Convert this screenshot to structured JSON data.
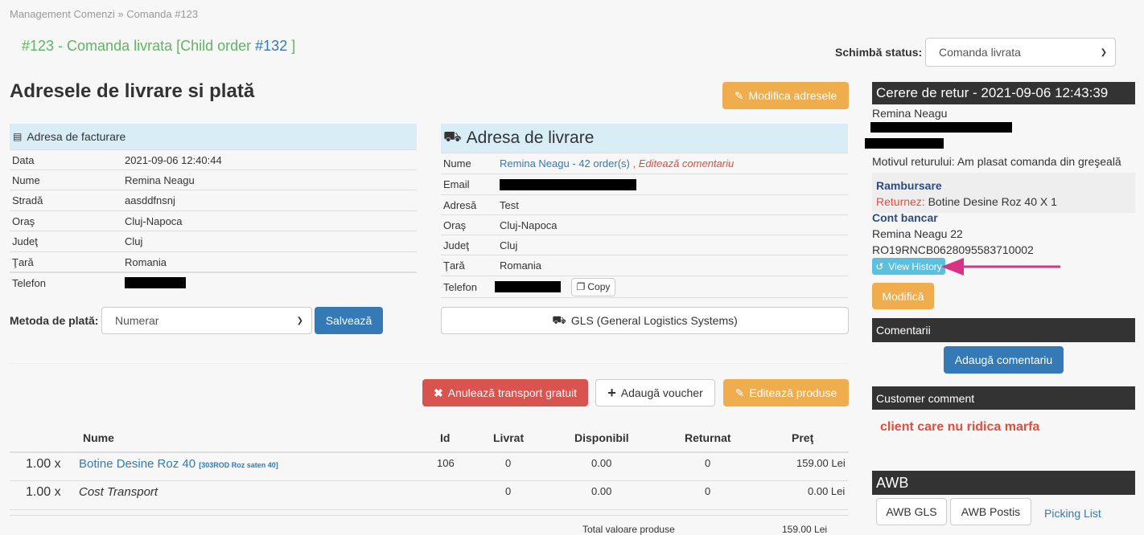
{
  "breadcrumb": "Management Comenzi » Comanda #123",
  "order_title": {
    "prefix": "#123 - Comanda livrata [Child order ",
    "link": "#132",
    "suffix": " ]"
  },
  "status": {
    "label": "Schimbă status:",
    "value": "Comanda livrata"
  },
  "addresses": {
    "heading": "Adresele de livrare si plată",
    "modify_label": "Modifica adresele"
  },
  "billing": {
    "title": "Adresa de facturare",
    "rows": [
      {
        "k": "Data",
        "v": "2021-09-06 12:40:44"
      },
      {
        "k": "Nume",
        "v": "Remina Neagu"
      },
      {
        "k": "Stradă",
        "v": "aasddfnsnj"
      },
      {
        "k": "Oraş",
        "v": "Cluj-Napoca"
      },
      {
        "k": "Judeţ",
        "v": "Cluj"
      },
      {
        "k": "Ţară",
        "v": "Romania"
      },
      {
        "k": "Telefon",
        "v": ""
      }
    ]
  },
  "shipping": {
    "title": "Adresa de livrare",
    "name_link": "Remina Neagu - 42 order(s)",
    "edit_comment": "Editează comentariu",
    "labels": [
      "Nume",
      "Email",
      "Adresă",
      "Oraş",
      "Judeţ",
      "Ţară",
      "Telefon"
    ],
    "address": "Test",
    "city": "Cluj-Napoca",
    "county": "Cluj",
    "country": "Romania",
    "copy_label": "Copy"
  },
  "payment": {
    "label": "Metoda de plată:",
    "value": "Numerar",
    "save_label": "Salvează"
  },
  "courier": "GLS (General Logistics Systems)",
  "actions": {
    "cancel": "Anulează transport gratuit",
    "voucher": "Adaugă voucher",
    "edit": "Editează produse"
  },
  "table": {
    "headers": [
      "Nume",
      "Id",
      "Livrat",
      "Disponibil",
      "Returnat",
      "Preţ"
    ],
    "rows": [
      {
        "qty": "1.00 x",
        "name": "Botine Desine Roz 40",
        "sku": "[303ROD Roz saten 40]",
        "id": "106",
        "livrat": "0",
        "disp": "0.00",
        "ret": "0",
        "price": "159.00 Lei"
      },
      {
        "qty": "1.00 x",
        "name": "Cost Transport",
        "sku": "",
        "id": "",
        "livrat": "0",
        "disp": "0.00",
        "ret": "0",
        "price": "0.00 Lei"
      }
    ],
    "total_label": "Total valoare produse",
    "total_value": "159.00 Lei"
  },
  "return": {
    "title": "Cerere de retur - 2021-09-06 12:43:39",
    "name": "Remina Neagu",
    "reason": "Motivul returului: Am plasat comanda din greşeală",
    "refund_title": "Rambursare",
    "returning_label": "Returnez:",
    "returning_item": "Botine Desine Roz 40 X 1",
    "bank_title": "Cont bancar",
    "bank_name": "Remina Neagu 22",
    "iban": "RO19RNCB0628095583710002",
    "history_label": "View History",
    "modify_label": "Modifică"
  },
  "comments": {
    "title": "Comentarii",
    "add_label": "Adaugă comentariu"
  },
  "customer_comment": {
    "title": "Customer comment",
    "text": "client care nu ridica marfa"
  },
  "awb": {
    "title": "AWB",
    "gls": "AWB GLS",
    "postis": "AWB Postis",
    "picking": "Picking List"
  },
  "colors": {
    "green": "#5cb85c",
    "blue": "#337ab7",
    "orange": "#f0ad4e",
    "red": "#d9534f",
    "dark": "#333333",
    "arrow": "#d63384"
  }
}
